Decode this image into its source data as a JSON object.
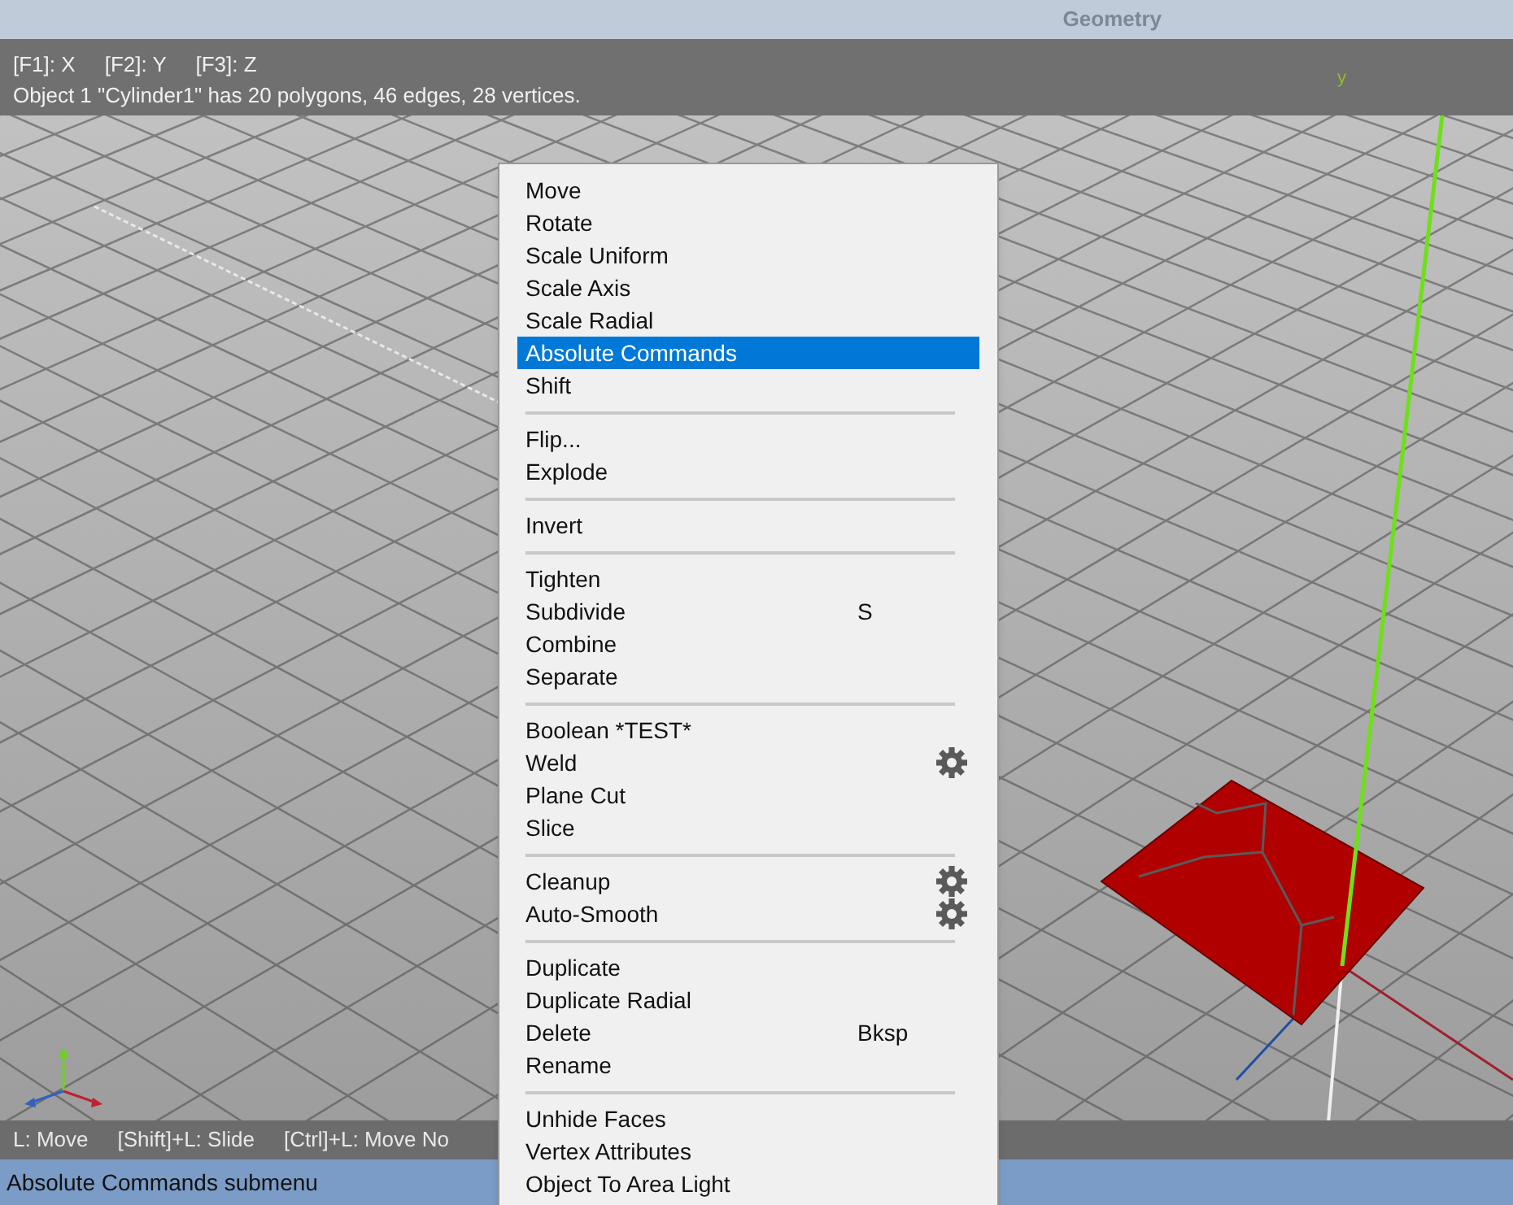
{
  "window": {
    "title": "Geometry"
  },
  "viewport": {
    "info_lines": [
      "[F1]: X     [F2]: Y     [F3]: Z",
      "Object 1 \"Cylinder1\" has 20 polygons, 46 edges, 28 vertices."
    ],
    "axis_label": "y",
    "hints": [
      "L: Move",
      "[Shift]+L: Slide",
      "[Ctrl]+L: Move No"
    ]
  },
  "context_menu": {
    "groups": [
      [
        {
          "label": "Move",
          "selected": false
        },
        {
          "label": "Rotate",
          "selected": false
        },
        {
          "label": "Scale Uniform",
          "selected": false
        },
        {
          "label": "Scale Axis",
          "selected": false
        },
        {
          "label": "Scale Radial",
          "selected": false
        },
        {
          "label": "Absolute Commands",
          "selected": true
        },
        {
          "label": "Shift",
          "selected": false
        }
      ],
      [
        {
          "label": "Flip...",
          "selected": false
        },
        {
          "label": "Explode",
          "selected": false
        }
      ],
      [
        {
          "label": "Invert",
          "selected": false
        }
      ],
      [
        {
          "label": "Tighten",
          "selected": false
        },
        {
          "label": "Subdivide",
          "shortcut": "S",
          "selected": false
        },
        {
          "label": "Combine",
          "selected": false
        },
        {
          "label": "Separate",
          "selected": false
        }
      ],
      [
        {
          "label": "Boolean *TEST*",
          "selected": false
        },
        {
          "label": "Weld",
          "selected": false,
          "has_options": true
        },
        {
          "label": "Plane Cut",
          "selected": false
        },
        {
          "label": "Slice",
          "selected": false
        }
      ],
      [
        {
          "label": "Cleanup",
          "selected": false,
          "has_options": true
        },
        {
          "label": "Auto-Smooth",
          "selected": false,
          "has_options": true
        }
      ],
      [
        {
          "label": "Duplicate",
          "selected": false
        },
        {
          "label": "Duplicate Radial",
          "selected": false
        },
        {
          "label": "Delete",
          "shortcut": "Bksp",
          "selected": false
        },
        {
          "label": "Rename",
          "selected": false
        }
      ],
      [
        {
          "label": "Unhide Faces",
          "selected": false
        },
        {
          "label": "Vertex Attributes",
          "selected": false
        },
        {
          "label": "Object To Area Light",
          "selected": false
        }
      ]
    ]
  },
  "status_bar": {
    "text": "Absolute Commands submenu"
  }
}
